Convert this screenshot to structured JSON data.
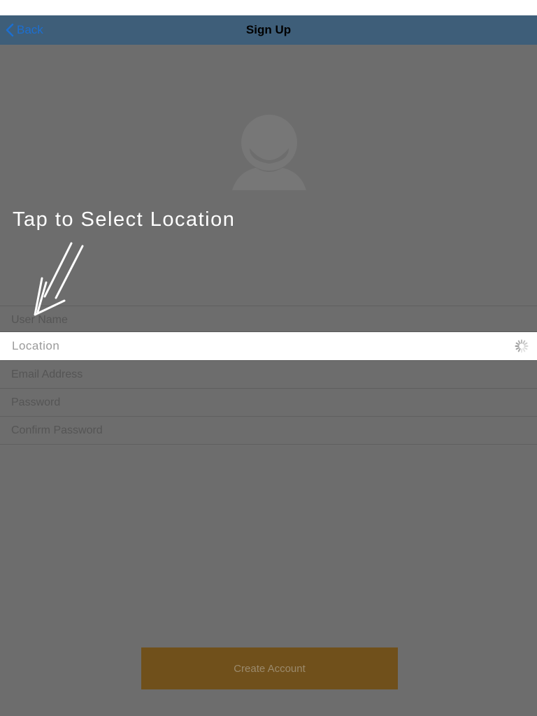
{
  "nav": {
    "back_label": "Back",
    "title": "Sign Up"
  },
  "hint": {
    "text": "Tap to Select Location"
  },
  "form": {
    "username_placeholder": "User Name",
    "location_label": "Location",
    "email_placeholder": "Email Address",
    "password_placeholder": "Password",
    "confirm_password_placeholder": "Confirm Password"
  },
  "create_account_label": "Create Account",
  "icons": {
    "back": "chevron-left-icon",
    "avatar": "user-avatar-icon",
    "spinner": "loading-spinner-icon",
    "hint_arrow": "arrow-icon"
  },
  "colors": {
    "navbar": "#3e5e79",
    "back_tint": "#1c6fd1",
    "overlay": "#6d6d6d",
    "create_button": "#70501b"
  }
}
